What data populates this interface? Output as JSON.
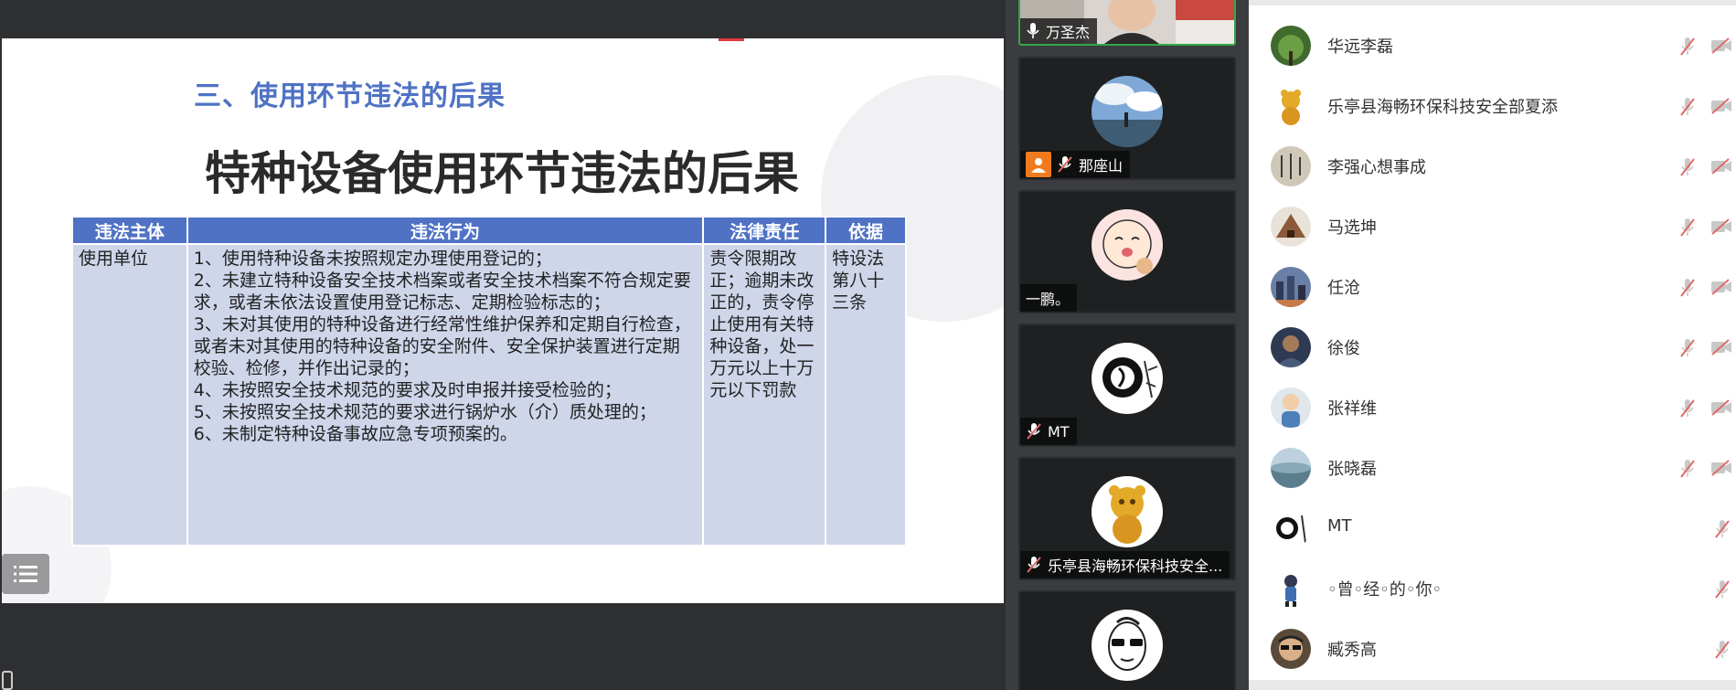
{
  "slide": {
    "section_title": "三、使用环节违法的后果",
    "main_title": "特种设备使用环节违法的后果",
    "table": {
      "headers": [
        "违法主体",
        "违法行为",
        "法律责任",
        "依据"
      ],
      "subject": "使用单位",
      "behaviors": [
        "1、使用特种设备未按照规定办理使用登记的；",
        "2、未建立特种设备安全技术档案或者安全技术档案不符合规定要求，或者未依法设置使用登记标志、定期检验标志的；",
        "3、未对其使用的特种设备进行经常性维护保养和定期自行检查，或者未对其使用的特种设备的安全附件、安全保护装置进行定期校验、检修，并作出记录的；",
        "4、未按照安全技术规范的要求及时申报并接受检验的；",
        "5、未按照安全技术规范的要求进行锅炉水（介）质处理的；",
        "6、未制定特种设备事故应急专项预案的。"
      ],
      "liability": "责令限期改正；逾期未改正的，责令停止使用有关特种设备，处一万元以上十万元以下罚款",
      "basis": "特设法第八十三条"
    }
  },
  "video_tiles": [
    {
      "name": "万圣杰",
      "icon": "mic-icon",
      "active": true
    },
    {
      "name": "那座山",
      "icon": "mic-muted-icon",
      "badge": "person-icon"
    },
    {
      "name": "一鹏。",
      "icon": ""
    },
    {
      "name": "MT",
      "icon": "mic-muted-icon"
    },
    {
      "name": "乐亭县海畅环保科技安全...",
      "icon": "mic-muted-icon"
    },
    {
      "name": "",
      "icon": ""
    }
  ],
  "participants": [
    {
      "name": "华远李磊",
      "mic": "muted",
      "cam": "off"
    },
    {
      "name": "乐亭县海畅环保科技安全部夏添",
      "mic": "muted",
      "cam": "off"
    },
    {
      "name": "李强心想事成",
      "mic": "muted",
      "cam": "off"
    },
    {
      "name": "马选坤",
      "mic": "muted",
      "cam": "off"
    },
    {
      "name": "任沧",
      "mic": "muted",
      "cam": "off"
    },
    {
      "name": "徐俊",
      "mic": "muted",
      "cam": "off"
    },
    {
      "name": "张祥维",
      "mic": "muted",
      "cam": "off"
    },
    {
      "name": "张晓磊",
      "mic": "muted",
      "cam": "off"
    },
    {
      "name": "MT",
      "mic": "muted"
    },
    {
      "name": "◦曾◦经◦的◦你◦",
      "mic": "muted"
    },
    {
      "name": "臧秀高",
      "mic": "muted"
    }
  ],
  "colors": {
    "accent": "#4f72c4",
    "table_cell": "#cfd6ea",
    "active_speaker": "#33a64a",
    "muted_icon": "#e06a6a"
  }
}
